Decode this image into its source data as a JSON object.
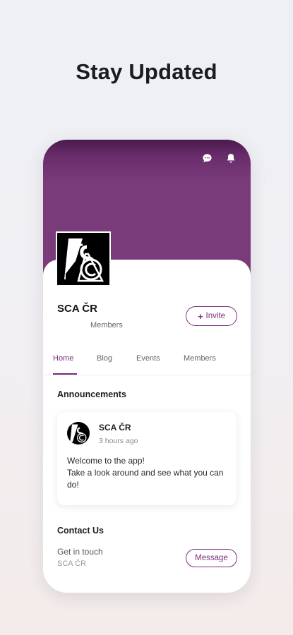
{
  "headline": "Stay Updated",
  "header": {
    "icons": [
      "chat-icon",
      "bell-icon"
    ],
    "cover_color": "#7a3b7b"
  },
  "group": {
    "name": "SCA ČR",
    "members_label": "Members",
    "invite_label": "Invite",
    "invite_icon": "plus-icon"
  },
  "tabs": [
    {
      "label": "Home",
      "active": true
    },
    {
      "label": "Blog",
      "active": false
    },
    {
      "label": "Events",
      "active": false
    },
    {
      "label": "Members",
      "active": false
    }
  ],
  "announcements": {
    "title": "Announcements",
    "post": {
      "author": "SCA ČR",
      "time": "3 hours ago",
      "body": "Welcome to the app!\nTake a look around and see what you can do!"
    }
  },
  "contact": {
    "title": "Contact Us",
    "label": "Get in touch",
    "sub": "SCA ČR",
    "button_label": "Message"
  },
  "colors": {
    "accent": "#7a2e7c",
    "cover": "#7a3b7b"
  }
}
